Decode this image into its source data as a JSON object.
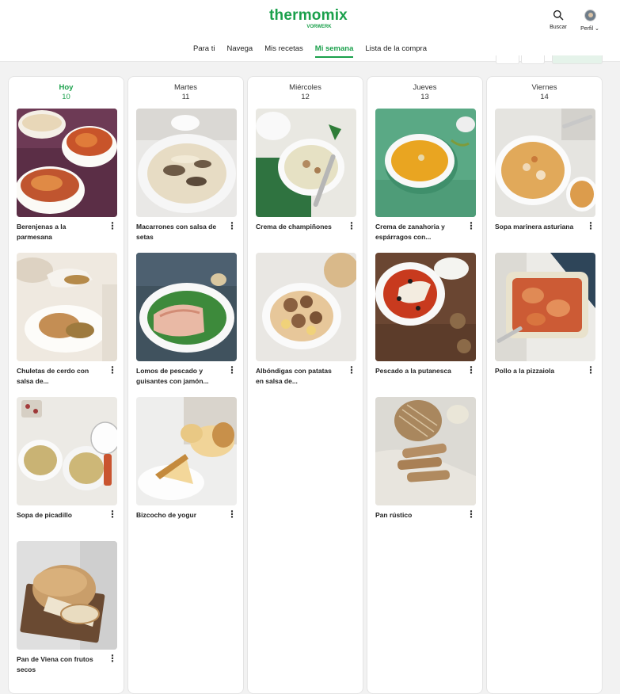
{
  "header": {
    "logo_text": "thermomix",
    "logo_sub": "VORWERK",
    "search_label": "Buscar",
    "profile_label": "Perfil",
    "brand_color": "#1aa04b",
    "search_icon": "search-icon",
    "profile_icon": "avatar"
  },
  "nav": {
    "items": [
      "Para ti",
      "Navega",
      "Mis recetas",
      "Mi semana",
      "Lista de la compra"
    ],
    "active": "Mi semana"
  },
  "week": [
    {
      "day": "Hoy",
      "date": "10",
      "today": true,
      "recipes": [
        {
          "title": "Berenjenas a la parmesana",
          "image": "eggplant-gratin-image"
        },
        {
          "title": "Chuletas de cerdo con salsa de...",
          "image": "pork-chops-image"
        },
        {
          "title": "Sopa de picadillo",
          "image": "picadillo-soup-image"
        },
        {
          "title": "Pan de Viena con frutos secos",
          "image": "vienna-bread-image"
        }
      ]
    },
    {
      "day": "Martes",
      "date": "11",
      "today": false,
      "recipes": [
        {
          "title": "Macarrones con salsa de setas",
          "image": "mushroom-macaroni-image"
        },
        {
          "title": "Lomos de pescado y guisantes con jamón...",
          "image": "fish-peas-image"
        },
        {
          "title": "Bizcocho de yogur",
          "image": "yogurt-cake-image"
        }
      ]
    },
    {
      "day": "Miércoles",
      "date": "12",
      "today": false,
      "recipes": [
        {
          "title": "Crema de champiñones",
          "image": "mushroom-cream-image"
        },
        {
          "title": "Albóndigas con patatas en salsa de...",
          "image": "meatballs-image"
        }
      ]
    },
    {
      "day": "Jueves",
      "date": "13",
      "today": false,
      "recipes": [
        {
          "title": "Crema de zanahoria y espárragos con...",
          "image": "carrot-cream-image"
        },
        {
          "title": "Pescado a la putanesca",
          "image": "fish-puttanesca-image"
        },
        {
          "title": "Pan rústico",
          "image": "rustic-bread-image"
        }
      ]
    },
    {
      "day": "Viernes",
      "date": "14",
      "today": false,
      "recipes": [
        {
          "title": "Sopa marinera asturiana",
          "image": "seafood-soup-image"
        },
        {
          "title": "Pollo a la pizzaiola",
          "image": "chicken-pizzaiola-image"
        }
      ]
    }
  ]
}
